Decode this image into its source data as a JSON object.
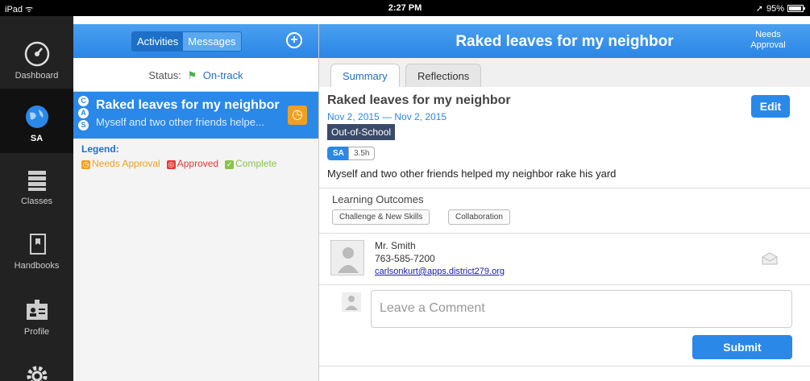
{
  "statusbar": {
    "device": "iPad",
    "time": "2:27 PM",
    "battery": "95%"
  },
  "nav": {
    "items": [
      {
        "label": "Dashboard",
        "icon": "dashboard-icon"
      },
      {
        "label": "SA",
        "icon": "globe-icon"
      },
      {
        "label": "Classes",
        "icon": "books-icon"
      },
      {
        "label": "Handbooks",
        "icon": "book-icon"
      },
      {
        "label": "Profile",
        "icon": "id-badge-icon"
      },
      {
        "label": "",
        "icon": "gear-icon"
      }
    ]
  },
  "middle": {
    "tabs": [
      "Activities",
      "Messages"
    ],
    "status_label": "Status:",
    "status_value": "On-track",
    "activity": {
      "letters": [
        "C",
        "A",
        "S"
      ],
      "title": "Raked leaves for my neighbor",
      "desc": "Myself and two other friends helpe..."
    },
    "legend_title": "Legend:",
    "legend": [
      {
        "label": "Needs Approval",
        "color": "#f0a020"
      },
      {
        "label": "Approved",
        "color": "#e53935"
      },
      {
        "label": "Complete",
        "color": "#8bc34a"
      }
    ]
  },
  "detail": {
    "title": "Raked leaves for my neighbor",
    "header_status": "Needs Approval",
    "tabs": [
      "Summary",
      "Reflections"
    ],
    "edit_label": "Edit",
    "dates": "Nov 2, 2015 — Nov 2, 2015",
    "category": "Out-of-School",
    "tag_sa": "SA",
    "hours": "3.5h",
    "description": "Myself and two other friends helped my neighbor rake his yard",
    "outcomes_title": "Learning Outcomes",
    "outcomes": [
      "Challenge & New Skills",
      "Collaboration"
    ],
    "contact": {
      "name": "Mr. Smith",
      "phone": "763-585-7200",
      "email": "carlsonkurt@apps.district279.org"
    },
    "comment_placeholder": "Leave a Comment",
    "submit_label": "Submit"
  },
  "colors": {
    "accent": "#2a88e8",
    "nav_bg": "#222222"
  }
}
